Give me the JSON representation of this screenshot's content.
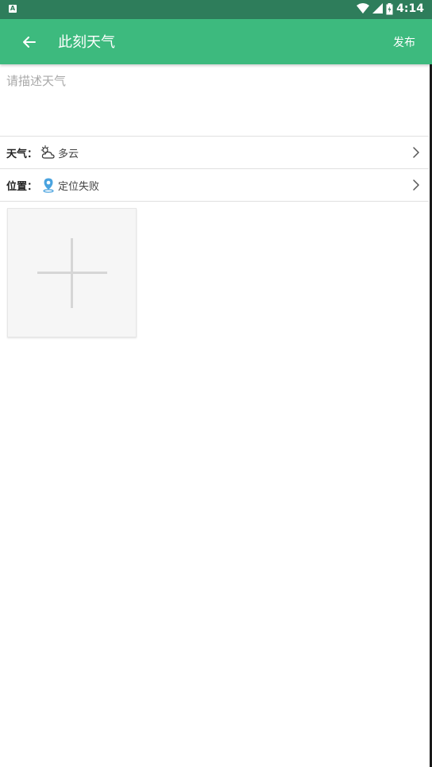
{
  "status_bar": {
    "time": "4:14",
    "notification_icon": "a-letter-icon"
  },
  "app_bar": {
    "title": "此刻天气",
    "publish_label": "发布",
    "back_icon": "arrow-left-icon"
  },
  "description": {
    "placeholder": "请描述天气",
    "value": ""
  },
  "weather_row": {
    "label": "天气：",
    "value": "多云",
    "icon": "cloudy-icon"
  },
  "location_row": {
    "label": "位置：",
    "value": "定位失败",
    "icon": "location-pin-icon"
  },
  "photos": {
    "add_icon": "plus-icon"
  },
  "colors": {
    "status_bar": "#2e7d5b",
    "app_bar": "#3dba7e",
    "pin": "#4aa3df"
  }
}
